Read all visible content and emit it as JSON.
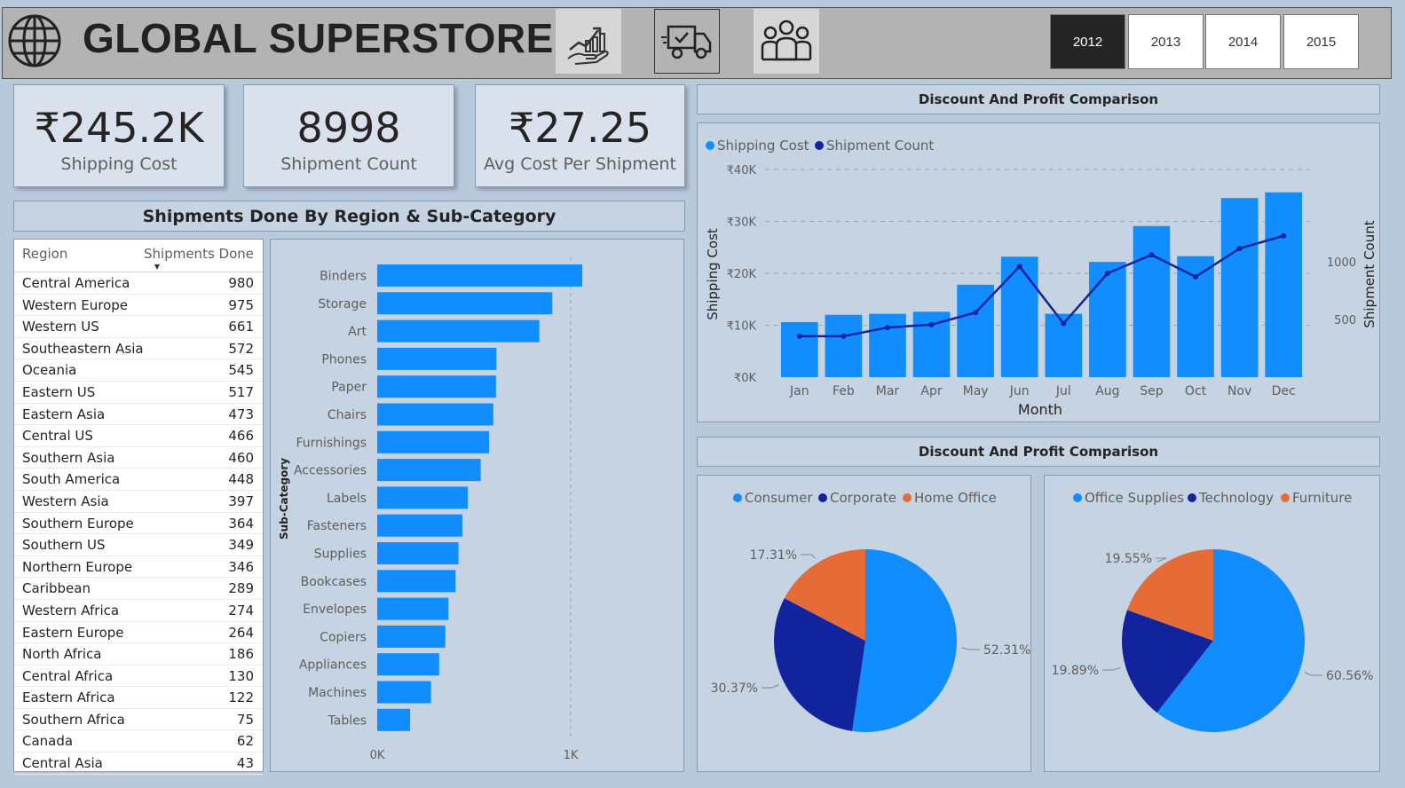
{
  "header": {
    "title": "GLOBAL SUPERSTORE",
    "nav_icons": [
      "growth-chart-icon",
      "delivery-truck-icon",
      "team-people-icon"
    ],
    "years": [
      {
        "label": "2012",
        "active": true
      },
      {
        "label": "2013",
        "active": false
      },
      {
        "label": "2014",
        "active": false
      },
      {
        "label": "2015",
        "active": false
      }
    ]
  },
  "kpis": [
    {
      "value": "₹245.2K",
      "label": "Shipping Cost"
    },
    {
      "value": "8998",
      "label": "Shipment Count"
    },
    {
      "value": "₹27.25",
      "label": "Avg Cost Per Shipment"
    }
  ],
  "region_section": {
    "title": "Shipments Done By Region & Sub-Category",
    "table": {
      "col_region": "Region",
      "col_shipments": "Shipments Done",
      "rows": [
        {
          "region": "Central America",
          "value": "980"
        },
        {
          "region": "Western Europe",
          "value": "975"
        },
        {
          "region": "Western US",
          "value": "661"
        },
        {
          "region": "Southeastern Asia",
          "value": "572"
        },
        {
          "region": "Oceania",
          "value": "545"
        },
        {
          "region": "Eastern US",
          "value": "517"
        },
        {
          "region": "Eastern Asia",
          "value": "473"
        },
        {
          "region": "Central US",
          "value": "466"
        },
        {
          "region": "Southern Asia",
          "value": "460"
        },
        {
          "region": "South America",
          "value": "448"
        },
        {
          "region": "Western Asia",
          "value": "397"
        },
        {
          "region": "Southern Europe",
          "value": "364"
        },
        {
          "region": "Southern US",
          "value": "349"
        },
        {
          "region": "Northern Europe",
          "value": "346"
        },
        {
          "region": "Caribbean",
          "value": "289"
        },
        {
          "region": "Western Africa",
          "value": "274"
        },
        {
          "region": "Eastern Europe",
          "value": "264"
        },
        {
          "region": "North Africa",
          "value": "186"
        },
        {
          "region": "Central Africa",
          "value": "130"
        },
        {
          "region": "Eastern Africa",
          "value": "122"
        },
        {
          "region": "Southern Africa",
          "value": "75"
        },
        {
          "region": "Canada",
          "value": "62"
        },
        {
          "region": "Central Asia",
          "value": "43"
        }
      ]
    }
  },
  "line_section": {
    "title": "Discount And Profit Comparison"
  },
  "pie_section": {
    "title": "Discount And Profit Comparison"
  },
  "colors": {
    "blue": "#118dff",
    "navy": "#12239e",
    "orange": "#e66c37"
  },
  "chart_data": [
    {
      "type": "bar",
      "orientation": "horizontal",
      "ylabel": "Sub-Category",
      "xlabel": "",
      "categories": [
        "Binders",
        "Storage",
        "Art",
        "Phones",
        "Paper",
        "Chairs",
        "Furnishings",
        "Accessories",
        "Labels",
        "Fasteners",
        "Supplies",
        "Bookcases",
        "Envelopes",
        "Copiers",
        "Appliances",
        "Machines",
        "Tables"
      ],
      "values": [
        1060,
        905,
        838,
        616,
        614,
        600,
        578,
        535,
        468,
        440,
        420,
        405,
        368,
        352,
        320,
        278,
        170
      ],
      "xticks": [
        "0K",
        "1K"
      ],
      "xlim": [
        0,
        1000
      ],
      "grid": true
    },
    {
      "type": "bar+line",
      "xlabel": "Month",
      "ylabel": "Shipping Cost",
      "y2label": "Shipment Count",
      "categories": [
        "Jan",
        "Feb",
        "Mar",
        "Apr",
        "May",
        "Jun",
        "Jul",
        "Aug",
        "Sep",
        "Oct",
        "Nov",
        "Dec"
      ],
      "series": [
        {
          "name": "Shipping Cost",
          "kind": "bar",
          "axis": "left",
          "values": [
            10600,
            12000,
            12200,
            12600,
            17800,
            23200,
            12200,
            22200,
            29100,
            23300,
            34500,
            35600
          ]
        },
        {
          "name": "Shipment Count",
          "kind": "line",
          "axis": "right",
          "values": [
            355,
            355,
            430,
            455,
            560,
            960,
            465,
            900,
            1060,
            870,
            1115,
            1225
          ]
        }
      ],
      "yticks": [
        "₹0K",
        "₹10K",
        "₹20K",
        "₹30K",
        "₹40K"
      ],
      "ylim": [
        0,
        40000
      ],
      "y2ticks": [
        "500",
        "1000"
      ],
      "y2lim": [
        0,
        1800
      ],
      "legend": "top-left",
      "grid": true
    },
    {
      "type": "pie",
      "legend": "top",
      "slices": [
        {
          "name": "Consumer",
          "value": 52.31,
          "label": "52.31%"
        },
        {
          "name": "Corporate",
          "value": 30.37,
          "label": "30.37%"
        },
        {
          "name": "Home Office",
          "value": 17.31,
          "label": "17.31%"
        }
      ]
    },
    {
      "type": "pie",
      "legend": "top",
      "slices": [
        {
          "name": "Office Supplies",
          "value": 60.56,
          "label": "60.56%"
        },
        {
          "name": "Technology",
          "value": 19.89,
          "label": "19.89%"
        },
        {
          "name": "Furniture",
          "value": 19.55,
          "label": "19.55%"
        }
      ]
    }
  ]
}
